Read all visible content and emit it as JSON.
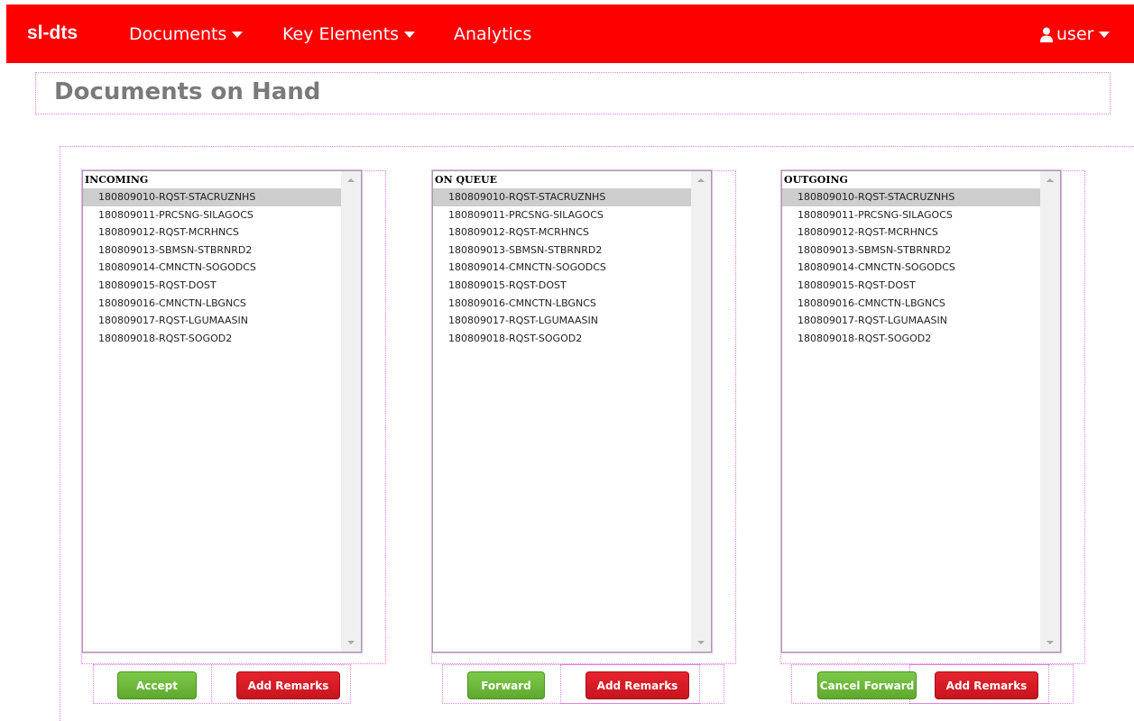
{
  "navbar": {
    "brand": "sl-dts",
    "documents": "Documents",
    "key_elements": "Key Elements",
    "analytics": "Analytics",
    "user": "user",
    "color": "#ff0000"
  },
  "page_title": "Documents on Hand",
  "panels": [
    {
      "header": "INCOMING",
      "items": [
        "180809010-RQST-STACRUZNHS",
        "180809011-PRCSNG-SILAGOCS",
        "180809012-RQST-MCRHNCS",
        "180809013-SBMSN-STBRNRD2",
        "180809014-CMNCTN-SOGODCS",
        "180809015-RQST-DOST",
        "180809016-CMNCTN-LBGNCS",
        "180809017-RQST-LGUMAASIN",
        "180809018-RQST-SOGOD2"
      ],
      "selected_index": 0,
      "primary_button": "Accept",
      "remarks_button": "Add Remarks"
    },
    {
      "header": "ON QUEUE",
      "items": [
        "180809010-RQST-STACRUZNHS",
        "180809011-PRCSNG-SILAGOCS",
        "180809012-RQST-MCRHNCS",
        "180809013-SBMSN-STBRNRD2",
        "180809014-CMNCTN-SOGODCS",
        "180809015-RQST-DOST",
        "180809016-CMNCTN-LBGNCS",
        "180809017-RQST-LGUMAASIN",
        "180809018-RQST-SOGOD2"
      ],
      "selected_index": 0,
      "primary_button": "Forward",
      "remarks_button": "Add Remarks"
    },
    {
      "header": "OUTGOING",
      "items": [
        "180809010-RQST-STACRUZNHS",
        "180809011-PRCSNG-SILAGOCS",
        "180809012-RQST-MCRHNCS",
        "180809013-SBMSN-STBRNRD2",
        "180809014-CMNCTN-SOGODCS",
        "180809015-RQST-DOST",
        "180809016-CMNCTN-LBGNCS",
        "180809017-RQST-LGUMAASIN",
        "180809018-RQST-SOGOD2"
      ],
      "selected_index": 0,
      "primary_button": "Cancel Forward",
      "remarks_button": "Add Remarks"
    }
  ],
  "colors": {
    "green_button": "#6bb83a",
    "red_button": "#d41a24",
    "selected_row": "#cdcdcd",
    "title_text": "#7a7a7a"
  }
}
